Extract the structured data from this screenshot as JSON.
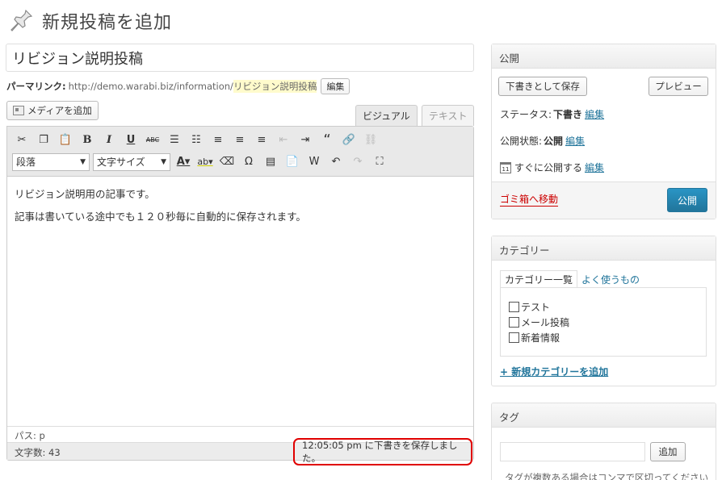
{
  "header": {
    "title": "新規投稿を追加",
    "icon": "pushpin-icon"
  },
  "post": {
    "title_value": "リビジョン説明投稿",
    "permalink_label": "パーマリンク:",
    "permalink_base": "http://demo.warabi.biz/information/",
    "permalink_slug": "リビジョン説明投稿",
    "permalink_edit": "編集",
    "media_button": "メディアを追加"
  },
  "editor": {
    "tabs": [
      {
        "label": "ビジュアル",
        "active": true
      },
      {
        "label": "テキスト",
        "active": false
      }
    ],
    "format_select": "段落",
    "fontsize_select": "文字サイズ",
    "content": [
      "リビジョン説明用の記事です。",
      "記事は書いている途中でも１２０秒毎に自動的に保存されます。"
    ],
    "path": "パス: p",
    "word_count": "文字数: 43",
    "autosave_message": "12:05:05 pm に下書きを保存しました。"
  },
  "publish_box": {
    "title": "公開",
    "save_draft": "下書きとして保存",
    "preview": "プレビュー",
    "status_label": "ステータス:",
    "status_value": "下書き",
    "visibility_label": "公開状態:",
    "visibility_value": "公開",
    "schedule_label": "すぐに公開する",
    "edit_link": "編集",
    "trash": "ゴミ箱へ移動",
    "publish": "公開",
    "publish_color": "#21759b",
    "trash_color": "#cc0000"
  },
  "category_box": {
    "title": "カテゴリー",
    "tab_all": "カテゴリー一覧",
    "tab_popular": "よく使うもの",
    "items": [
      "テスト",
      "メール投稿",
      "新着情報"
    ],
    "add_new": "+ 新規カテゴリーを追加"
  },
  "tag_box": {
    "title": "タグ",
    "add_button": "追加",
    "hint": "タグが複数ある場合はコンマで区切ってください"
  }
}
